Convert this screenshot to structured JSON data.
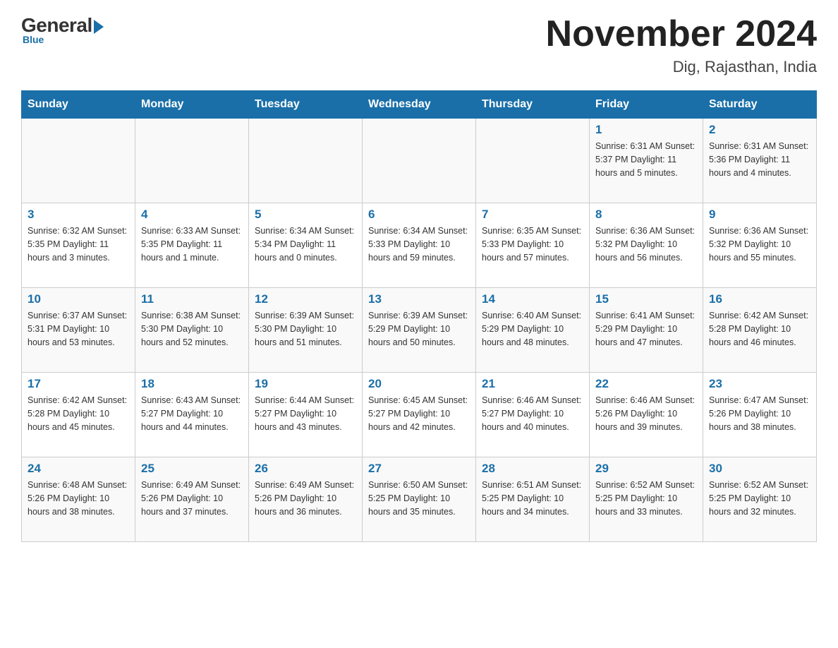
{
  "header": {
    "logo_general": "General",
    "logo_blue": "Blue",
    "month_title": "November 2024",
    "location": "Dig, Rajasthan, India"
  },
  "days_of_week": [
    "Sunday",
    "Monday",
    "Tuesday",
    "Wednesday",
    "Thursday",
    "Friday",
    "Saturday"
  ],
  "weeks": [
    [
      {
        "day": "",
        "info": ""
      },
      {
        "day": "",
        "info": ""
      },
      {
        "day": "",
        "info": ""
      },
      {
        "day": "",
        "info": ""
      },
      {
        "day": "",
        "info": ""
      },
      {
        "day": "1",
        "info": "Sunrise: 6:31 AM\nSunset: 5:37 PM\nDaylight: 11 hours and 5 minutes."
      },
      {
        "day": "2",
        "info": "Sunrise: 6:31 AM\nSunset: 5:36 PM\nDaylight: 11 hours and 4 minutes."
      }
    ],
    [
      {
        "day": "3",
        "info": "Sunrise: 6:32 AM\nSunset: 5:35 PM\nDaylight: 11 hours and 3 minutes."
      },
      {
        "day": "4",
        "info": "Sunrise: 6:33 AM\nSunset: 5:35 PM\nDaylight: 11 hours and 1 minute."
      },
      {
        "day": "5",
        "info": "Sunrise: 6:34 AM\nSunset: 5:34 PM\nDaylight: 11 hours and 0 minutes."
      },
      {
        "day": "6",
        "info": "Sunrise: 6:34 AM\nSunset: 5:33 PM\nDaylight: 10 hours and 59 minutes."
      },
      {
        "day": "7",
        "info": "Sunrise: 6:35 AM\nSunset: 5:33 PM\nDaylight: 10 hours and 57 minutes."
      },
      {
        "day": "8",
        "info": "Sunrise: 6:36 AM\nSunset: 5:32 PM\nDaylight: 10 hours and 56 minutes."
      },
      {
        "day": "9",
        "info": "Sunrise: 6:36 AM\nSunset: 5:32 PM\nDaylight: 10 hours and 55 minutes."
      }
    ],
    [
      {
        "day": "10",
        "info": "Sunrise: 6:37 AM\nSunset: 5:31 PM\nDaylight: 10 hours and 53 minutes."
      },
      {
        "day": "11",
        "info": "Sunrise: 6:38 AM\nSunset: 5:30 PM\nDaylight: 10 hours and 52 minutes."
      },
      {
        "day": "12",
        "info": "Sunrise: 6:39 AM\nSunset: 5:30 PM\nDaylight: 10 hours and 51 minutes."
      },
      {
        "day": "13",
        "info": "Sunrise: 6:39 AM\nSunset: 5:29 PM\nDaylight: 10 hours and 50 minutes."
      },
      {
        "day": "14",
        "info": "Sunrise: 6:40 AM\nSunset: 5:29 PM\nDaylight: 10 hours and 48 minutes."
      },
      {
        "day": "15",
        "info": "Sunrise: 6:41 AM\nSunset: 5:29 PM\nDaylight: 10 hours and 47 minutes."
      },
      {
        "day": "16",
        "info": "Sunrise: 6:42 AM\nSunset: 5:28 PM\nDaylight: 10 hours and 46 minutes."
      }
    ],
    [
      {
        "day": "17",
        "info": "Sunrise: 6:42 AM\nSunset: 5:28 PM\nDaylight: 10 hours and 45 minutes."
      },
      {
        "day": "18",
        "info": "Sunrise: 6:43 AM\nSunset: 5:27 PM\nDaylight: 10 hours and 44 minutes."
      },
      {
        "day": "19",
        "info": "Sunrise: 6:44 AM\nSunset: 5:27 PM\nDaylight: 10 hours and 43 minutes."
      },
      {
        "day": "20",
        "info": "Sunrise: 6:45 AM\nSunset: 5:27 PM\nDaylight: 10 hours and 42 minutes."
      },
      {
        "day": "21",
        "info": "Sunrise: 6:46 AM\nSunset: 5:27 PM\nDaylight: 10 hours and 40 minutes."
      },
      {
        "day": "22",
        "info": "Sunrise: 6:46 AM\nSunset: 5:26 PM\nDaylight: 10 hours and 39 minutes."
      },
      {
        "day": "23",
        "info": "Sunrise: 6:47 AM\nSunset: 5:26 PM\nDaylight: 10 hours and 38 minutes."
      }
    ],
    [
      {
        "day": "24",
        "info": "Sunrise: 6:48 AM\nSunset: 5:26 PM\nDaylight: 10 hours and 38 minutes."
      },
      {
        "day": "25",
        "info": "Sunrise: 6:49 AM\nSunset: 5:26 PM\nDaylight: 10 hours and 37 minutes."
      },
      {
        "day": "26",
        "info": "Sunrise: 6:49 AM\nSunset: 5:26 PM\nDaylight: 10 hours and 36 minutes."
      },
      {
        "day": "27",
        "info": "Sunrise: 6:50 AM\nSunset: 5:25 PM\nDaylight: 10 hours and 35 minutes."
      },
      {
        "day": "28",
        "info": "Sunrise: 6:51 AM\nSunset: 5:25 PM\nDaylight: 10 hours and 34 minutes."
      },
      {
        "day": "29",
        "info": "Sunrise: 6:52 AM\nSunset: 5:25 PM\nDaylight: 10 hours and 33 minutes."
      },
      {
        "day": "30",
        "info": "Sunrise: 6:52 AM\nSunset: 5:25 PM\nDaylight: 10 hours and 32 minutes."
      }
    ]
  ]
}
